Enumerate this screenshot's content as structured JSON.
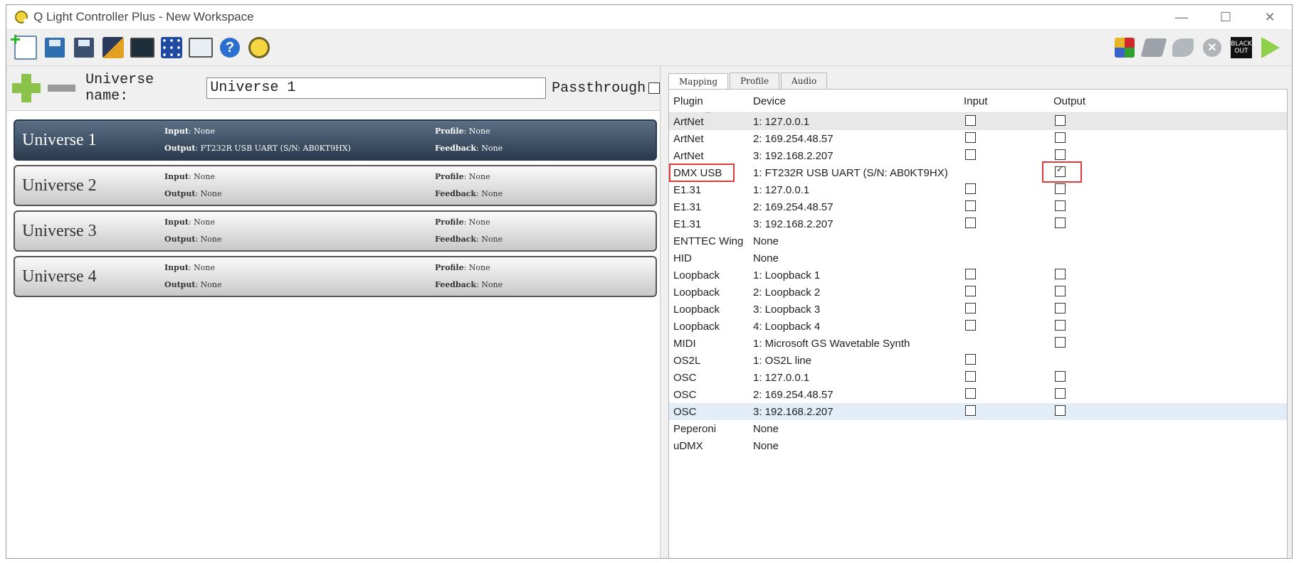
{
  "window": {
    "title": "Q Light Controller Plus - New Workspace",
    "minimize": "—",
    "maximize": "☐",
    "close": "✕"
  },
  "toolbar": {
    "left_icons": [
      "new-workspace-icon",
      "open-workspace-icon",
      "save-workspace-icon",
      "save-as-icon",
      "monitor-icon",
      "address-tool-icon",
      "window-icon",
      "help-icon",
      "qlc-about-icon"
    ],
    "right_icons": [
      "puzzle-icon",
      "fade-out-icon",
      "stop-functions-icon",
      "panic-icon",
      "blackout-icon",
      "play-icon"
    ],
    "blackout_line1": "BLACK",
    "blackout_line2": "OUT",
    "help_glyph": "?",
    "stop_glyph": "✕"
  },
  "universe_editor": {
    "name_label": "Universe name:",
    "name_value": "Universe 1",
    "passthrough_label": "Passthrough"
  },
  "universes": [
    {
      "name": "Universe 1",
      "input_label": "Input",
      "input": "None",
      "output_label": "Output",
      "output": "FT232R USB UART (S/N: AB0KT9HX)",
      "profile_label": "Profile",
      "profile": "None",
      "feedback_label": "Feedback",
      "feedback": "None",
      "selected": true
    },
    {
      "name": "Universe 2",
      "input_label": "Input",
      "input": "None",
      "output_label": "Output",
      "output": "None",
      "profile_label": "Profile",
      "profile": "None",
      "feedback_label": "Feedback",
      "feedback": "None",
      "selected": false
    },
    {
      "name": "Universe 3",
      "input_label": "Input",
      "input": "None",
      "output_label": "Output",
      "output": "None",
      "profile_label": "Profile",
      "profile": "None",
      "feedback_label": "Feedback",
      "feedback": "None",
      "selected": false
    },
    {
      "name": "Universe 4",
      "input_label": "Input",
      "input": "None",
      "output_label": "Output",
      "output": "None",
      "profile_label": "Profile",
      "profile": "None",
      "feedback_label": "Feedback",
      "feedback": "None",
      "selected": false
    }
  ],
  "tabs": [
    "Mapping",
    "Profile",
    "Audio"
  ],
  "mapping": {
    "columns": {
      "plugin": "Plugin",
      "device": "Device",
      "input": "Input",
      "output": "Output"
    },
    "rows": [
      {
        "plugin": "ArtNet",
        "device": "1: 127.0.0.1",
        "input": false,
        "output": false,
        "has_input": true,
        "has_output": true,
        "style": "gray"
      },
      {
        "plugin": "ArtNet",
        "device": "2: 169.254.48.57",
        "input": false,
        "output": false,
        "has_input": true,
        "has_output": true
      },
      {
        "plugin": "ArtNet",
        "device": "3: 192.168.2.207",
        "input": false,
        "output": false,
        "has_input": true,
        "has_output": true
      },
      {
        "plugin": "DMX USB",
        "device": "1: FT232R USB UART (S/N: AB0KT9HX)",
        "input": false,
        "output": true,
        "has_input": false,
        "has_output": true,
        "highlighted": true
      },
      {
        "plugin": "E1.31",
        "device": "1: 127.0.0.1",
        "input": false,
        "output": false,
        "has_input": true,
        "has_output": true
      },
      {
        "plugin": "E1.31",
        "device": "2: 169.254.48.57",
        "input": false,
        "output": false,
        "has_input": true,
        "has_output": true
      },
      {
        "plugin": "E1.31",
        "device": "3: 192.168.2.207",
        "input": false,
        "output": false,
        "has_input": true,
        "has_output": true
      },
      {
        "plugin": "ENTTEC Wing",
        "device": "None",
        "has_input": false,
        "has_output": false
      },
      {
        "plugin": "HID",
        "device": "None",
        "has_input": false,
        "has_output": false
      },
      {
        "plugin": "Loopback",
        "device": "1: Loopback 1",
        "input": false,
        "output": false,
        "has_input": true,
        "has_output": true
      },
      {
        "plugin": "Loopback",
        "device": "2: Loopback 2",
        "input": false,
        "output": false,
        "has_input": true,
        "has_output": true
      },
      {
        "plugin": "Loopback",
        "device": "3: Loopback 3",
        "input": false,
        "output": false,
        "has_input": true,
        "has_output": true
      },
      {
        "plugin": "Loopback",
        "device": "4: Loopback 4",
        "input": false,
        "output": false,
        "has_input": true,
        "has_output": true
      },
      {
        "plugin": "MIDI",
        "device": "1: Microsoft GS Wavetable Synth",
        "output": false,
        "has_input": false,
        "has_output": true
      },
      {
        "plugin": "OS2L",
        "device": "1: OS2L line",
        "input": false,
        "has_input": true,
        "has_output": false
      },
      {
        "plugin": "OSC",
        "device": "1: 127.0.0.1",
        "input": false,
        "output": false,
        "has_input": true,
        "has_output": true
      },
      {
        "plugin": "OSC",
        "device": "2: 169.254.48.57",
        "input": false,
        "output": false,
        "has_input": true,
        "has_output": true
      },
      {
        "plugin": "OSC",
        "device": "3: 192.168.2.207",
        "input": false,
        "output": false,
        "has_input": true,
        "has_output": true,
        "style": "hl"
      },
      {
        "plugin": "Peperoni",
        "device": "None",
        "has_input": false,
        "has_output": false
      },
      {
        "plugin": "uDMX",
        "device": "None",
        "has_input": false,
        "has_output": false
      }
    ]
  },
  "colors": {
    "highlight_box": "#e23b3b",
    "selected_universe": "#2b3b4f",
    "selected_row": "#e3edf7"
  }
}
